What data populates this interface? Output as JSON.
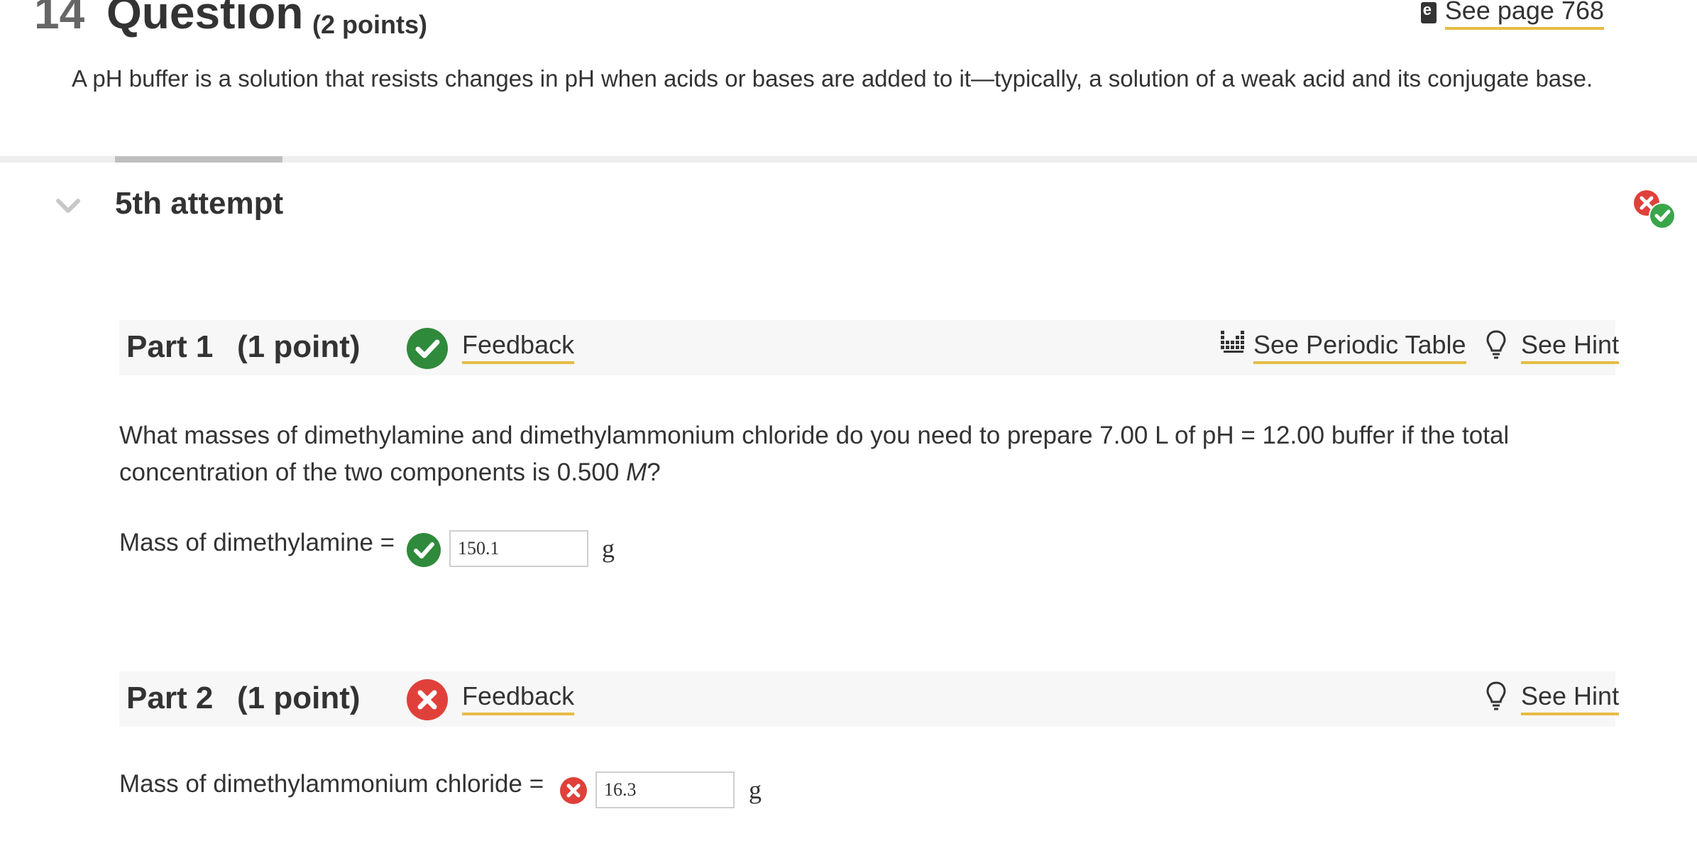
{
  "question": {
    "number": "14",
    "word": "Question",
    "points": "(2 points)",
    "see_page": "See page 768",
    "intro": "A pH buffer is a solution that resists changes in pH when acids or bases are added to it—typically, a solution of a weak acid and its conjugate base."
  },
  "attempt": {
    "label": "5th attempt"
  },
  "part1": {
    "title": "Part 1",
    "points": "(1 point)",
    "status": "correct",
    "feedback": "Feedback",
    "periodic_table": "See Periodic Table",
    "hint": "See Hint",
    "question_a": "What masses of dimethylamine and dimethylammonium chloride do you need to prepare 7.00 L of pH = 12.00 buffer if the total concentration of the two components is 0.500 ",
    "question_unit": "M",
    "question_end": "?",
    "field_label": "Mass of dimethylamine =",
    "value": "150.1",
    "unit": "g"
  },
  "part2": {
    "title": "Part 2",
    "points": "(1 point)",
    "status": "incorrect",
    "feedback": "Feedback",
    "hint": "See Hint",
    "field_label": "Mass of dimethylammonium chloride =",
    "value": "16.3",
    "unit": "g"
  },
  "colors": {
    "correct": "#2f8a3b",
    "incorrect": "#e0403a",
    "link_underline": "#e6bc45"
  }
}
